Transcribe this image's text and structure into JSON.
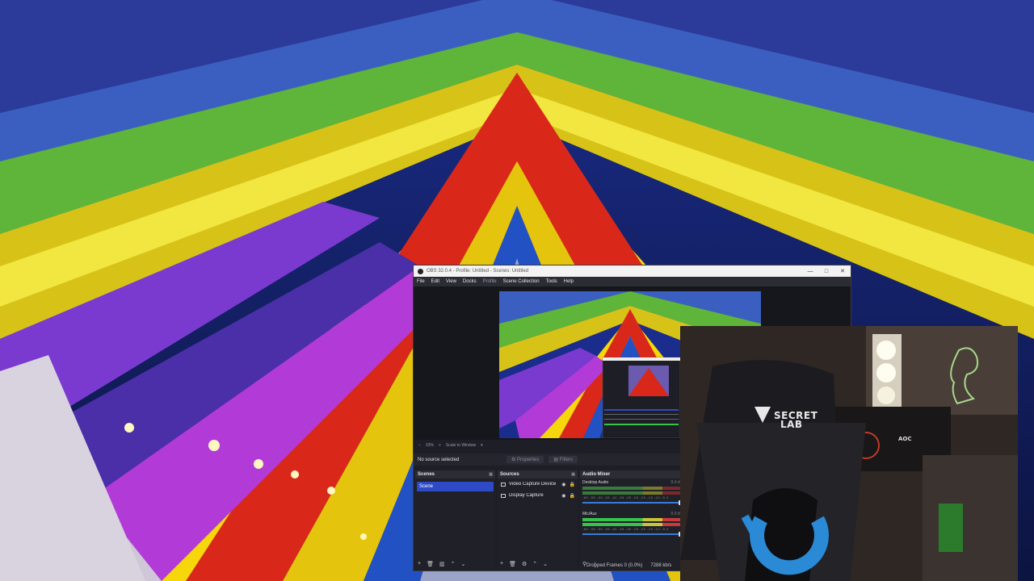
{
  "window": {
    "title": "OBS 32.0.4 - Profile: Untitled - Scenes: Untitled",
    "controls": [
      "—",
      "□",
      "✕"
    ]
  },
  "menu": {
    "items": [
      "File",
      "Edit",
      "View",
      "Docks",
      "Profile",
      "Scene Collection",
      "Tools",
      "Help"
    ]
  },
  "preview": {
    "zoom": "33%",
    "zoom_plus": "+",
    "scale_mode": "Scale to Window"
  },
  "properties_bar": {
    "no_source": "No source selected",
    "properties_label": "Properties",
    "filters_label": "Filters"
  },
  "scenes": {
    "header": "Scenes",
    "items": [
      "Scene"
    ]
  },
  "sources": {
    "header": "Sources",
    "items": [
      "Video Capture Device",
      "Display Capture"
    ]
  },
  "mixer": {
    "header": "Audio Mixer",
    "channels": [
      {
        "name": "Desktop Audio",
        "db": "0.0 dB"
      },
      {
        "name": "Mic/Aux",
        "db": "0.0 dB"
      }
    ],
    "scale": "-60 -55 -50 -45 -40 -35 -30 -25 -20 -15 -10 -5 0"
  },
  "statusbar": {
    "dropped": "Dropped Frames 0 (0.0%)",
    "kbps": "7288 kb/s"
  },
  "webcam": {
    "chair_brand_line1": "SECRET",
    "chair_brand_line2": "LAB",
    "monitor_brand": "AOC"
  },
  "colors": {
    "obs_bg": "#1e1f26",
    "selected_scene": "#2e4ac6",
    "meter_green": "#37c34a"
  },
  "icons": [
    "obs-app-icon",
    "gear-icon",
    "filter-icon",
    "plus-icon",
    "trash-icon",
    "eye-icon",
    "lock-icon",
    "arrow-up-icon",
    "arrow-down-icon",
    "speaker-icon"
  ]
}
